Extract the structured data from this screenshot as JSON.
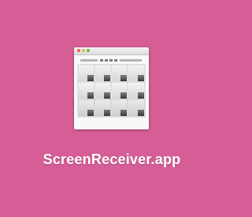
{
  "desktop": {
    "background_color": "#d65d96"
  },
  "file": {
    "name": "ScreenReceiver.app",
    "icon": "screen-receiver-app-icon"
  }
}
